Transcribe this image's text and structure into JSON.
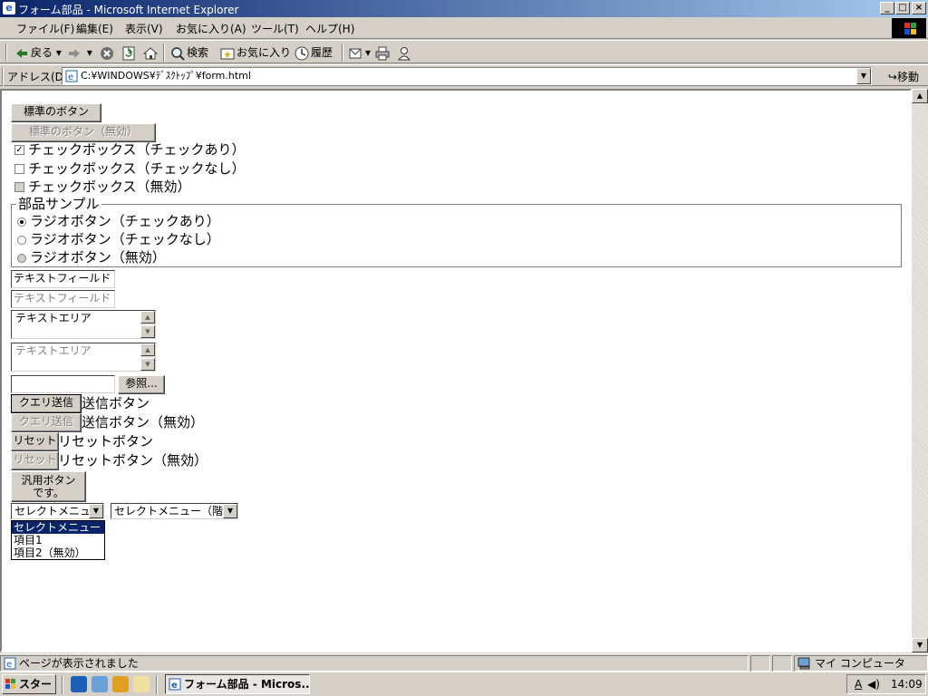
{
  "window": {
    "title": "フォーム部品 - Microsoft Internet Explorer",
    "minimize": "_",
    "maximize": "□",
    "close": "×"
  },
  "menu": [
    "ファイル(F)",
    "編集(E)",
    "表示(V)",
    "お気に入り(A)",
    "ツール(T)",
    "ヘルプ(H)"
  ],
  "toolbar": {
    "back": "戻る",
    "search": "検索",
    "favorites": "お気に入り",
    "history": "履歴"
  },
  "address": {
    "label": "アドレス(D)",
    "value": "C:¥WINDOWS¥ﾃﾞｽｸﾄｯﾌﾟ¥form.html",
    "go": "移動"
  },
  "form": {
    "standard_button": "標準のボタン",
    "standard_button_disabled": "標準のボタン（無効）",
    "checkbox_checked": "チェックボックス（チェックあり）",
    "checkbox_unchecked": "チェックボックス（チェックなし）",
    "checkbox_disabled": "チェックボックス（無効）",
    "fieldset_legend": "部品サンプル",
    "radio_checked": "ラジオボタン（チェックあり）",
    "radio_unchecked": "ラジオボタン（チェックなし）",
    "radio_disabled": "ラジオボタン（無効）",
    "textfield_value": "テキストフィールド",
    "textfield_disabled_value": "テキストフィールド（無効）",
    "textarea_value": "テキストエリア",
    "textarea_disabled_value": "テキストエリア",
    "file_browse": "参照...",
    "submit_label": "クエリ送信",
    "submit_text": "送信ボタン",
    "submit_disabled_label": "クエリ送信",
    "submit_disabled_text": "送信ボタン（無効）",
    "reset_label": "リセット",
    "reset_text": "リセットボタン",
    "reset_disabled_label": "リセット",
    "reset_disabled_text": "リセットボタン（無効）",
    "generic_button_line1": "汎用ボタン",
    "generic_button_line2": "です。",
    "select_value": "セレクトメニュー",
    "select_options": [
      "セレクトメニュー",
      "項目1",
      "項目2（無効）"
    ],
    "select_grouped_value": "セレクトメニュー（階層）"
  },
  "status": {
    "text": "ページが表示されました",
    "zone": "マイ コンピュータ"
  },
  "taskbar": {
    "start": "スタート",
    "task": "フォーム部品 - Micros...",
    "tray_ime": "A",
    "clock": "14:09"
  }
}
